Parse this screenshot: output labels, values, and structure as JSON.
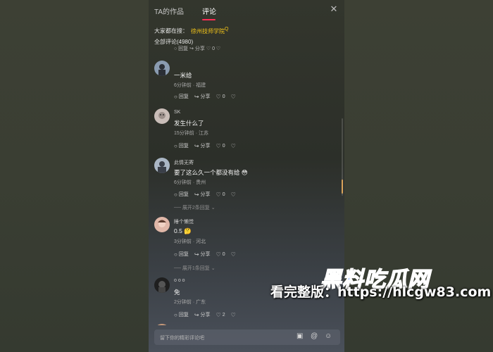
{
  "tabs": {
    "works": "TA的作品",
    "comments": "评论"
  },
  "search_hint": {
    "prefix": "大家都在搜：",
    "link": "徐州技师学院",
    "icon": "Q"
  },
  "comment_count": "全部评论(4980)",
  "cut_row": {
    "text": "○ 回复  ↪ 分享  ♡ 0  ♡"
  },
  "comments": [
    {
      "name": "",
      "text": "一米给",
      "meta": "6分钟前 · 福建",
      "reply": "回复",
      "share": "分享",
      "likes": "0",
      "avatar_color": "#7d8ea0"
    },
    {
      "name": "SK",
      "text": "发生什么了",
      "meta": "15分钟前 · 江苏",
      "reply": "回复",
      "share": "分享",
      "likes": "0",
      "avatar_color": "#b8aaa6"
    },
    {
      "name": "此情无寄",
      "text": "要了这么久一个都没有给 😳",
      "meta": "6分钟前 · 贵州",
      "reply": "回复",
      "share": "分享",
      "likes": "0",
      "avatar_color": "#6d7885",
      "expand": "展开2条回复"
    },
    {
      "name": "睡个懒觉",
      "text": "0.5 🤔",
      "meta": "3分钟前 · 河北",
      "reply": "回复",
      "share": "分享",
      "likes": "0",
      "avatar_color": "#c78a7c",
      "expand": "展开1条回复"
    },
    {
      "name": "o o o",
      "text": "免",
      "meta": "2分钟前 · 广东",
      "reply": "回复",
      "share": "分享",
      "likes": "2",
      "avatar_color": "#3a3a3a"
    }
  ],
  "input": {
    "placeholder": "留下你的精彩评论吧"
  },
  "icons": {
    "close": "close-icon",
    "reply": "chat-bubble-icon",
    "share": "share-arrow-icon",
    "like": "heart-icon",
    "dislike": "broken-heart-icon",
    "image": "image-icon",
    "at": "at-icon",
    "emoji": "smiley-icon"
  },
  "watermark": {
    "line1": "黑料吃瓜网",
    "line2": "看完整版：https://hlcgw83.com"
  },
  "colors": {
    "accent": "#fe2c55",
    "link": "#f5c518",
    "watermark_blue": "#1e6cff"
  }
}
